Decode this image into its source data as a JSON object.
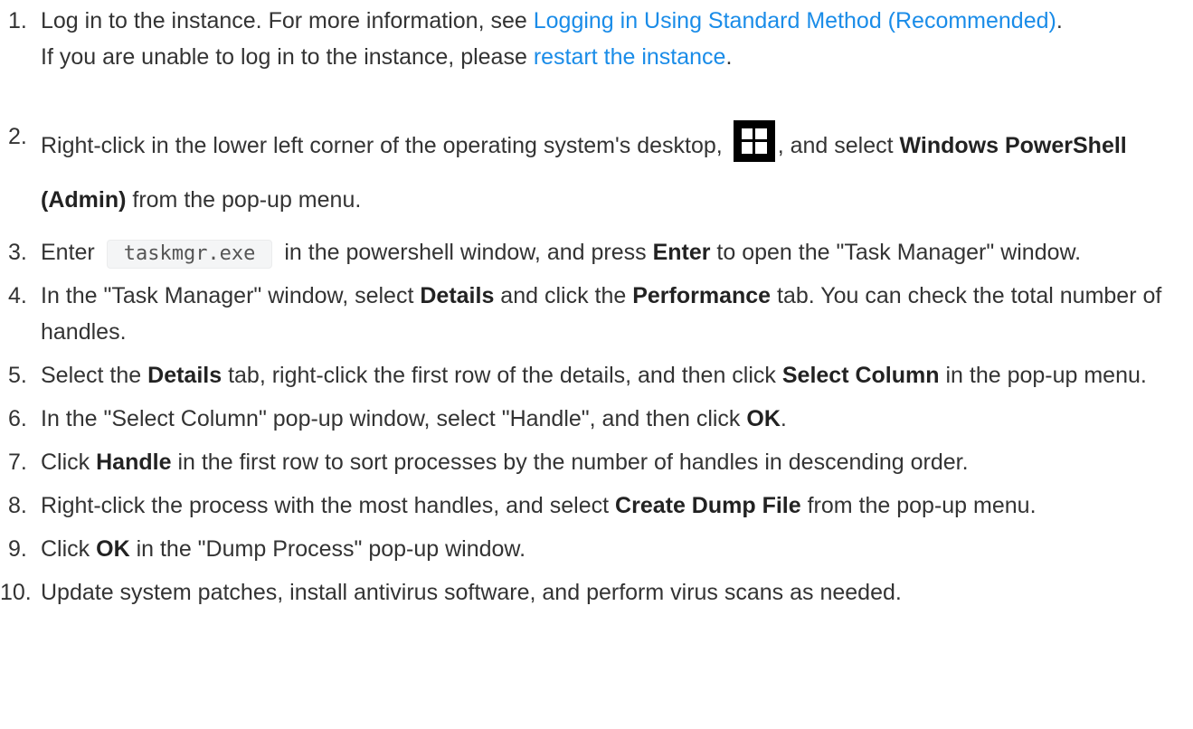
{
  "steps": [
    {
      "num": "1.",
      "a": "Log in to the instance. For more information, see",
      "link1": "Logging in Using Standard Method (Recommended)",
      "b": ".",
      "c": "If you are unable to log in to the instance, please",
      "link2": "restart the instance",
      "d": "."
    },
    {
      "num": "2.",
      "a": "Right-click in the lower left corner of the operating system's desktop,",
      "icon": "windows-start-icon",
      "b": ", and select",
      "bold": "Windows PowerShell (Admin)",
      "c": "from the pop-up menu."
    },
    {
      "num": "3.",
      "a": "Enter",
      "code": "taskmgr.exe",
      "b": "in the powershell window, and press",
      "bold": "Enter",
      "c": "to open the \"Task Manager\" window."
    },
    {
      "num": "4.",
      "a": "In the \"Task Manager\" window, select",
      "bold1": "Details",
      "b": "and click the",
      "bold2": "Performance",
      "c": "tab. You can check the total number of handles."
    },
    {
      "num": "5.",
      "a": "Select the",
      "bold1": "Details",
      "b": "tab, right-click the first row of the details, and then click",
      "bold2": "Select Column",
      "c": "in the pop-up menu."
    },
    {
      "num": "6.",
      "a": "In the \"Select Column\" pop-up window, select \"Handle\", and then click",
      "bold": "OK",
      "b": "."
    },
    {
      "num": "7.",
      "a": "Click",
      "bold": "Handle",
      "b": "in the first row to sort processes by the number of handles in descending order."
    },
    {
      "num": "8.",
      "a": "Right-click the process with the most handles, and select",
      "bold": "Create Dump File",
      "b": "from the pop-up menu."
    },
    {
      "num": "9.",
      "a": "Click",
      "bold": "OK",
      "b": "in the \"Dump Process\" pop-up window."
    },
    {
      "num": "10.",
      "a": "Update system patches, install antivirus software, and perform virus scans as needed."
    }
  ],
  "colors": {
    "link": "#1a8ce8",
    "text": "#333333",
    "code_bg": "#f4f5f6"
  }
}
